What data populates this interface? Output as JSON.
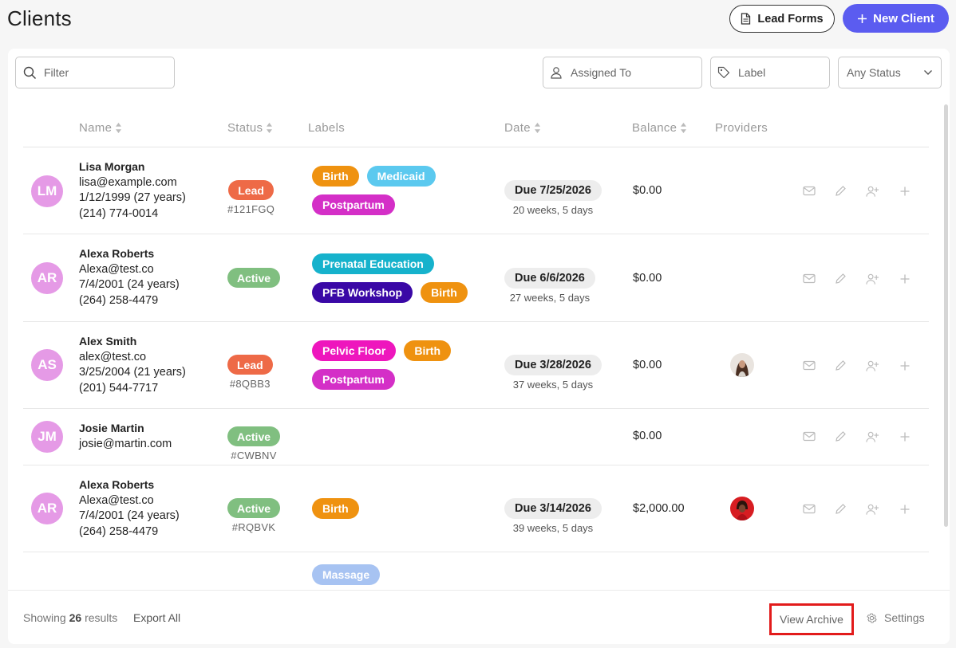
{
  "header": {
    "title": "Clients",
    "lead_forms_label": "Lead Forms",
    "new_client_label": "New Client"
  },
  "toolbar": {
    "filter_placeholder": "Filter",
    "assigned_placeholder": "Assigned To",
    "label_placeholder": "Label",
    "status_value": "Any Status"
  },
  "table": {
    "columns": {
      "name": "Name",
      "status": "Status",
      "labels": "Labels",
      "date": "Date",
      "balance": "Balance",
      "providers": "Providers"
    },
    "rows": [
      {
        "initials": "LM",
        "name": "Lisa Morgan",
        "email": "lisa@example.com",
        "dob": "1/12/1999 (27 years)",
        "phone": "(214) 774-0014",
        "status": "Lead",
        "code": "#121FGQ",
        "labels": [
          "Birth",
          "Medicaid",
          "Postpartum"
        ],
        "due": "Due 7/25/2026",
        "weeks": "20 weeks, 5 days",
        "balance": "$0.00"
      },
      {
        "initials": "AR",
        "name": "Alexa Roberts",
        "email": "Alexa@test.co",
        "dob": "7/4/2001 (24 years)",
        "phone": "(264) 258-4479",
        "status": "Active",
        "code": "",
        "labels": [
          "Prenatal Education",
          "PFB Workshop",
          "Birth"
        ],
        "due": "Due 6/6/2026",
        "weeks": "27 weeks, 5 days",
        "balance": "$0.00"
      },
      {
        "initials": "AS",
        "name": "Alex Smith",
        "email": "alex@test.co",
        "dob": "3/25/2004 (21 years)",
        "phone": "(201) 544-7717",
        "status": "Lead",
        "code": "#8QBB3",
        "labels": [
          "Pelvic Floor",
          "Birth",
          "Postpartum"
        ],
        "due": "Due 3/28/2026",
        "weeks": "37 weeks, 5 days",
        "balance": "$0.00"
      },
      {
        "initials": "JM",
        "name": "Josie Martin",
        "email": "josie@martin.com",
        "dob": "",
        "phone": "",
        "status": "Active",
        "code": "#CWBNV",
        "labels": [],
        "due": "",
        "weeks": "",
        "balance": "$0.00"
      },
      {
        "initials": "AR",
        "name": "Alexa Roberts",
        "email": "Alexa@test.co",
        "dob": "7/4/2001 (24 years)",
        "phone": "(264) 258-4479",
        "status": "Active",
        "code": "#RQBVK",
        "labels": [
          "Birth"
        ],
        "due": "Due 3/14/2026",
        "weeks": "39 weeks, 5 days",
        "balance": "$2,000.00"
      },
      {
        "labels": [
          "Massage"
        ]
      }
    ]
  },
  "footer": {
    "showing_prefix": "Showing",
    "result_count": "26",
    "showing_suffix": "results",
    "export_label": "Export All",
    "archive_label": "View Archive",
    "settings_label": "Settings"
  },
  "colors": {
    "accent": "#5b5cf0",
    "lead": "#ee6a47",
    "active": "#80bf80",
    "avatar": "#e59ae6",
    "birth": "#ef9210",
    "medicaid": "#5bc9ef",
    "postpartum": "#d42fc7",
    "prenatal": "#16b2cc",
    "pfb": "#3a08a6",
    "pelvic": "#ee16bd",
    "massage": "#a7c3f2",
    "highlight": "#e21b1b"
  }
}
